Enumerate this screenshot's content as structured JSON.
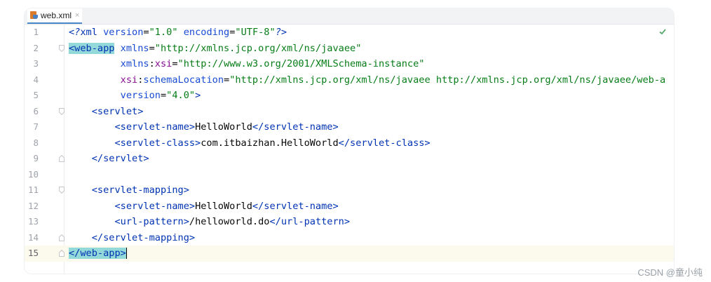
{
  "tab": {
    "label": "web.xml",
    "icon": "xml-file-icon",
    "close_glyph": "×"
  },
  "status": {
    "inspection_icon": "checkmark-icon",
    "color": "#59a869"
  },
  "lines": [
    {
      "n": "1",
      "fold": "none",
      "segments": [
        [
          "pi",
          "<?"
        ],
        [
          "tag",
          "xml "
        ],
        [
          "attr",
          "version"
        ],
        [
          "plain",
          "="
        ],
        [
          "val",
          "\"1.0\""
        ],
        [
          "plain",
          " "
        ],
        [
          "attr",
          "encoding"
        ],
        [
          "plain",
          "="
        ],
        [
          "val",
          "\"UTF-8\""
        ],
        [
          "pi",
          "?>"
        ]
      ]
    },
    {
      "n": "2",
      "fold": "open",
      "segments": [
        [
          "hl-tag",
          "<web-app"
        ],
        [
          "plain",
          " "
        ],
        [
          "attr",
          "xmlns"
        ],
        [
          "plain",
          "="
        ],
        [
          "val",
          "\"http://xmlns.jcp.org/xml/ns/javaee\""
        ]
      ]
    },
    {
      "n": "3",
      "fold": "none",
      "segments": [
        [
          "plain",
          "         "
        ],
        [
          "attr",
          "xmlns"
        ],
        [
          "plain",
          ":"
        ],
        [
          "ns",
          "xsi"
        ],
        [
          "plain",
          "="
        ],
        [
          "val",
          "\"http://www.w3.org/2001/XMLSchema-instance\""
        ]
      ]
    },
    {
      "n": "4",
      "fold": "none",
      "segments": [
        [
          "plain",
          "         "
        ],
        [
          "ns",
          "xsi"
        ],
        [
          "plain",
          ":"
        ],
        [
          "attr",
          "schemaLocation"
        ],
        [
          "plain",
          "="
        ],
        [
          "val",
          "\"http://xmlns.jcp.org/xml/ns/javaee http://xmlns.jcp.org/xml/ns/javaee/web-a"
        ]
      ]
    },
    {
      "n": "5",
      "fold": "none",
      "segments": [
        [
          "plain",
          "         "
        ],
        [
          "attr",
          "version"
        ],
        [
          "plain",
          "="
        ],
        [
          "val",
          "\"4.0\""
        ],
        [
          "tag",
          ">"
        ]
      ]
    },
    {
      "n": "6",
      "fold": "open",
      "segments": [
        [
          "plain",
          "    "
        ],
        [
          "tag",
          "<servlet>"
        ]
      ]
    },
    {
      "n": "7",
      "fold": "none",
      "segments": [
        [
          "plain",
          "        "
        ],
        [
          "tag",
          "<servlet-name>"
        ],
        [
          "plain",
          "HelloWorld"
        ],
        [
          "tag",
          "</servlet-name>"
        ]
      ]
    },
    {
      "n": "8",
      "fold": "none",
      "segments": [
        [
          "plain",
          "        "
        ],
        [
          "tag",
          "<servlet-class>"
        ],
        [
          "plain",
          "com.itbaizhan.HelloWorld"
        ],
        [
          "tag",
          "</servlet-class>"
        ]
      ]
    },
    {
      "n": "9",
      "fold": "close",
      "segments": [
        [
          "plain",
          "    "
        ],
        [
          "tag",
          "</servlet>"
        ]
      ]
    },
    {
      "n": "10",
      "fold": "none",
      "segments": []
    },
    {
      "n": "11",
      "fold": "open",
      "segments": [
        [
          "plain",
          "    "
        ],
        [
          "tag",
          "<servlet-mapping>"
        ]
      ]
    },
    {
      "n": "12",
      "fold": "none",
      "segments": [
        [
          "plain",
          "        "
        ],
        [
          "tag",
          "<servlet-name>"
        ],
        [
          "plain",
          "HelloWorld"
        ],
        [
          "tag",
          "</servlet-name>"
        ]
      ]
    },
    {
      "n": "13",
      "fold": "none",
      "segments": [
        [
          "plain",
          "        "
        ],
        [
          "tag",
          "<url-pattern>"
        ],
        [
          "plain",
          "/helloworld.do"
        ],
        [
          "tag",
          "</url-pattern>"
        ]
      ]
    },
    {
      "n": "14",
      "fold": "close",
      "segments": [
        [
          "plain",
          "    "
        ],
        [
          "tag",
          "</servlet-mapping>"
        ]
      ]
    },
    {
      "n": "15",
      "fold": "close",
      "segments": [
        [
          "hl-tag",
          "</web-app>"
        ]
      ],
      "current": true
    }
  ],
  "watermark": "CSDN @童小纯"
}
